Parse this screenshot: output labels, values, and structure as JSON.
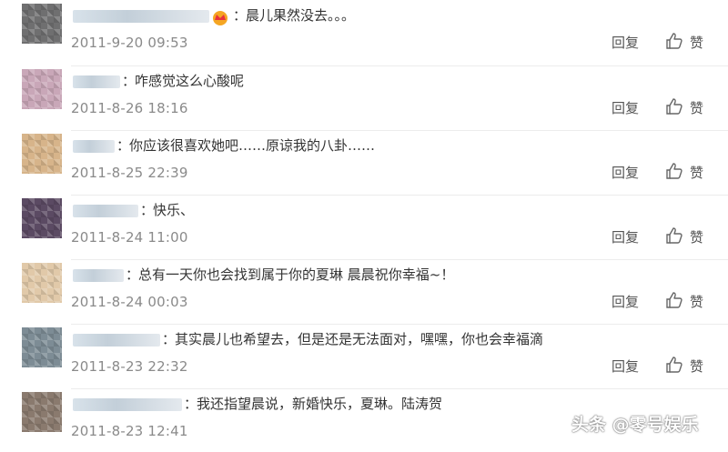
{
  "comments": [
    {
      "text": "晨儿果然没去。。。",
      "time": "2011-9-20 09:53",
      "reply_label": "回复",
      "like_label": "赞",
      "has_vip_badge": true
    },
    {
      "text": "咋感觉这么心酸呢",
      "time": "2011-8-26 18:16",
      "reply_label": "回复",
      "like_label": "赞"
    },
    {
      "text": "你应该很喜欢她吧……原谅我的八卦……",
      "time": "2011-8-25 22:39",
      "reply_label": "回复",
      "like_label": "赞"
    },
    {
      "text": "快乐、",
      "time": "2011-8-24 11:00",
      "reply_label": "回复",
      "like_label": "赞"
    },
    {
      "text": "总有一天你也会找到属于你的夏琳 晨晨祝你幸福~！",
      "time": "2011-8-24 00:03",
      "reply_label": "回复",
      "like_label": "赞"
    },
    {
      "text": "其实晨儿也希望去，但是还是无法面对，嘿嘿，你也会幸福滴",
      "time": "2011-8-23 22:32",
      "reply_label": "回复",
      "like_label": "赞"
    },
    {
      "text": "我还指望晨说，新婚快乐，夏琳。陆涛贺",
      "time": "2011-8-23 12:41",
      "reply_label": "回复",
      "like_label": "赞"
    }
  ],
  "watermark": "头条 @零号娱乐",
  "colors": {
    "text": "#333333",
    "time": "#8a8a8a",
    "divider": "#ececec",
    "action": "#555555"
  }
}
